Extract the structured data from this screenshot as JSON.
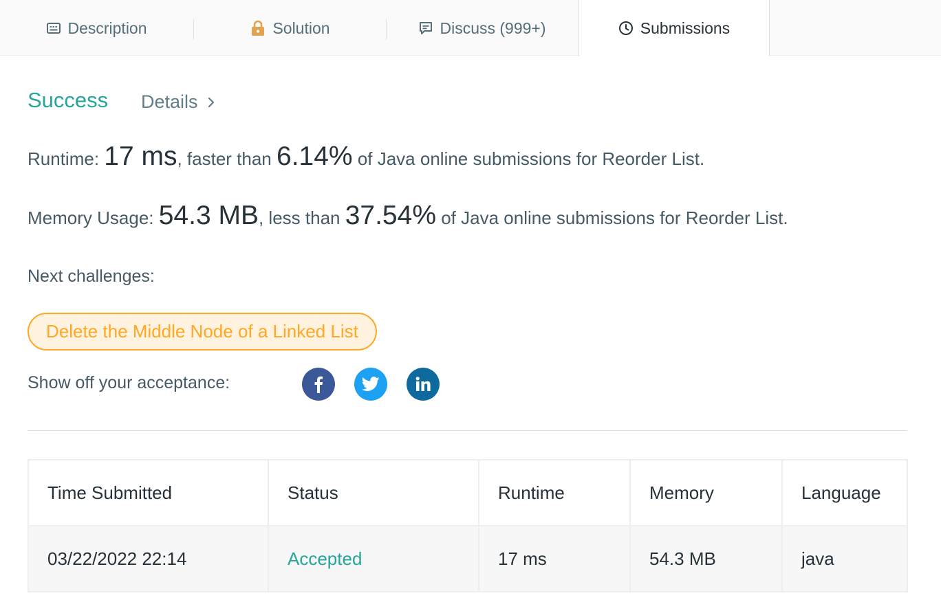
{
  "tabs": [
    {
      "label": "Description",
      "icon": "description-icon",
      "active": false
    },
    {
      "label": "Solution",
      "icon": "lock-icon",
      "active": false
    },
    {
      "label": "Discuss (999+)",
      "icon": "discuss-icon",
      "active": false
    },
    {
      "label": "Submissions",
      "icon": "clock-icon",
      "active": true
    }
  ],
  "result": {
    "status": "Success",
    "details_label": "Details",
    "runtime": {
      "label": "Runtime: ",
      "value": "17 ms",
      "mid": ", faster than ",
      "percent": "6.14%",
      "suffix": " of Java online submissions for Reorder List."
    },
    "memory": {
      "label": "Memory Usage: ",
      "value": "54.3 MB",
      "mid": ", less than ",
      "percent": "37.54%",
      "suffix": " of Java online submissions for Reorder List."
    },
    "next_challenges_label": "Next challenges:",
    "next_challenge": "Delete the Middle Node of a Linked List",
    "share_label": "Show off your acceptance:",
    "social": [
      "facebook-icon",
      "twitter-icon",
      "linkedin-icon"
    ]
  },
  "colors": {
    "success": "#26a69a",
    "challenge": "#ffa726",
    "facebook": "#3b5998",
    "twitter": "#1da1f2",
    "linkedin": "#0e6a9c"
  },
  "table": {
    "headers": [
      "Time Submitted",
      "Status",
      "Runtime",
      "Memory",
      "Language"
    ],
    "rows": [
      [
        "03/22/2022 22:14",
        "Accepted",
        "17 ms",
        "54.3 MB",
        "java"
      ]
    ]
  }
}
